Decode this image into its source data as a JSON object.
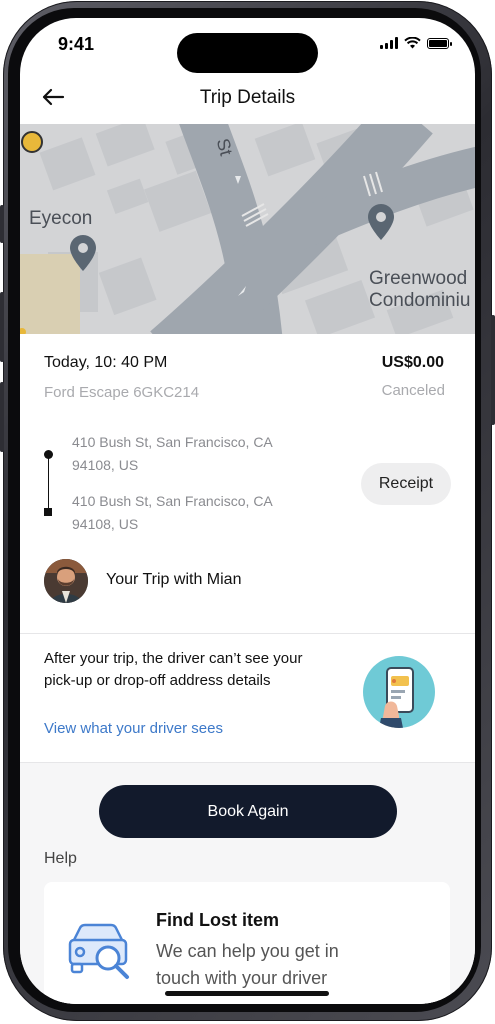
{
  "status_bar": {
    "time": "9:41"
  },
  "header": {
    "title": "Trip Details",
    "back_icon": "arrow-left-icon"
  },
  "map": {
    "labels": {
      "street": "St",
      "poi_left": "Eyecon",
      "poi_right_line1": "Greenwood",
      "poi_right_line2": "Condominiu"
    }
  },
  "trip": {
    "datetime": "Today, 10: 40 PM",
    "price": "US$0.00",
    "vehicle": "Ford Escape 6GKC214",
    "status": "Canceled",
    "pickup_line1": "410 Bush St, San Francisco, CA",
    "pickup_line2": "94108, US",
    "dropoff_line1": "410 Bush St, San Francisco, CA",
    "dropoff_line2": "94108, US",
    "receipt_label": "Receipt"
  },
  "driver": {
    "trip_with": "Your Trip with Mian"
  },
  "privacy": {
    "message": "After your trip, the driver can’t see your pick-up or drop-off address details",
    "link": "View what your driver sees"
  },
  "actions": {
    "book_again": "Book Again"
  },
  "help": {
    "label": "Help",
    "lost_item_title": "Find Lost item",
    "lost_item_desc": "We can help you get in touch with your driver"
  },
  "colors": {
    "primary_button": "#121a2c",
    "link": "#3d79c9",
    "map_marker": "#e8b83a",
    "muted_text": "#a9aaae"
  }
}
